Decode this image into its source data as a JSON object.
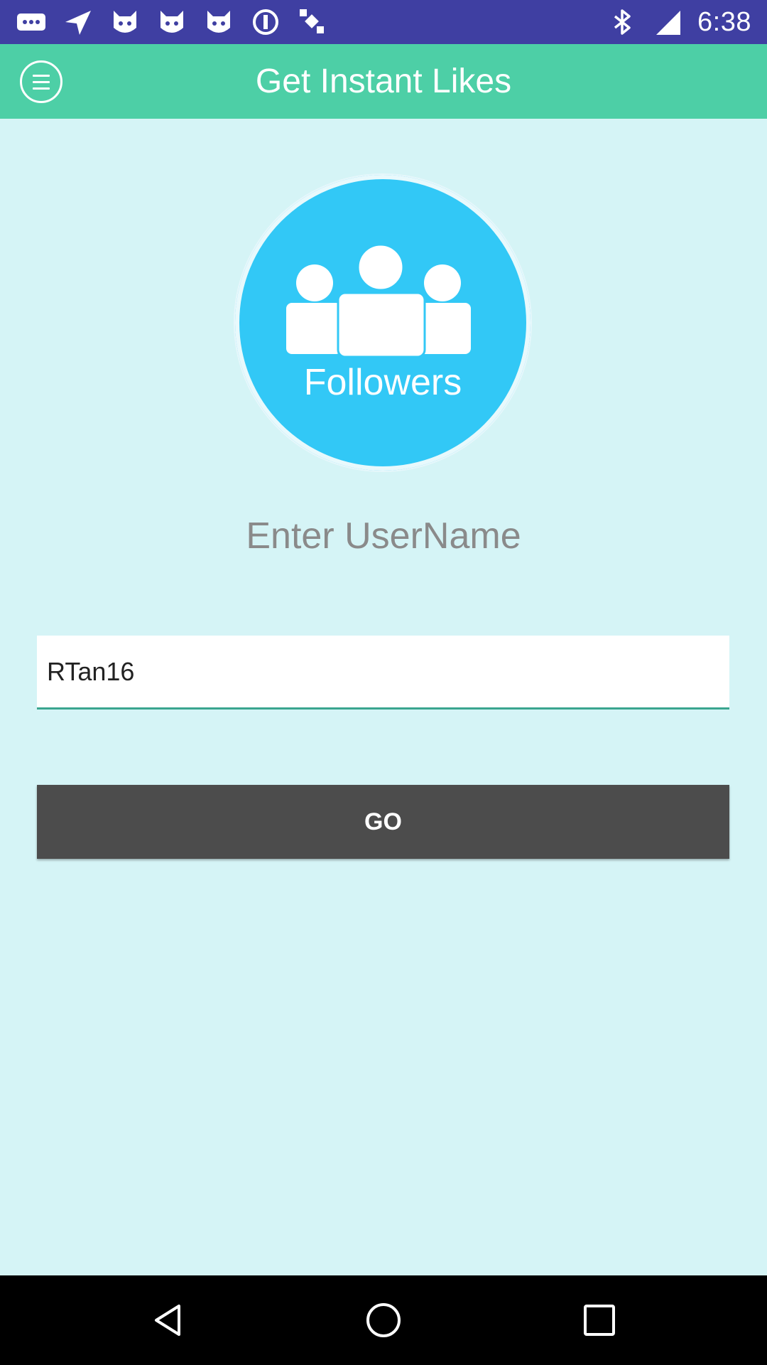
{
  "status_bar": {
    "time": "6:38",
    "left_icons": [
      "more-dots-icon",
      "navigation-arrow-icon",
      "cat-face-icon",
      "cat-face-icon",
      "cat-face-icon",
      "sync-icon",
      "satellite-icon"
    ],
    "right_icons": [
      "bluetooth-icon",
      "signal-icon"
    ],
    "color": "#3f3fa2"
  },
  "app_bar": {
    "title": "Get Instant Likes",
    "menu_icon": "menu-icon",
    "color": "#4dcfa6"
  },
  "logo": {
    "label": "Followers",
    "color": "#32c8f6"
  },
  "form": {
    "prompt": "Enter UserName",
    "username_value": "RTan16",
    "go_label": "GO",
    "button_color": "#4c4c4c"
  },
  "nav_bar": {
    "buttons": [
      "back-icon",
      "home-icon",
      "recents-icon"
    ]
  }
}
